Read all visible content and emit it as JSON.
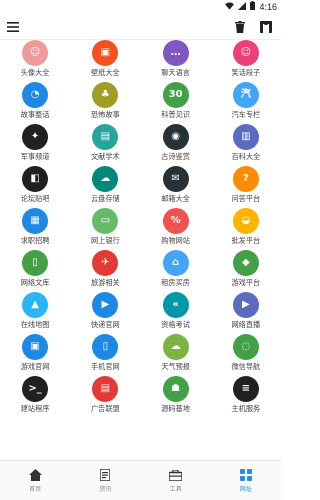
{
  "status_bar": {
    "time": "4:16"
  },
  "app_bar": {
    "menu_icon": "hamburger-menu-icon",
    "delete_icon": "trash-icon",
    "github_icon": "github-icon"
  },
  "grid": [
    {
      "label": "头像大全",
      "icon": "avatar-icon",
      "color": "#ef9a9a",
      "glyph": "☺"
    },
    {
      "label": "壁纸大全",
      "icon": "wallpaper-icon",
      "color": "#f4511e",
      "glyph": "▣"
    },
    {
      "label": "聊天语言",
      "icon": "chat-icon",
      "color": "#7e57c2",
      "glyph": "…"
    },
    {
      "label": "笑话段子",
      "icon": "joke-icon",
      "color": "#ec407a",
      "glyph": "☺"
    },
    {
      "label": "故事整话",
      "icon": "story-icon",
      "color": "#1e88e5",
      "glyph": "◔"
    },
    {
      "label": "恐怖故事",
      "icon": "horror-icon",
      "color": "#9e9d24",
      "glyph": "♣"
    },
    {
      "label": "科普见识",
      "icon": "science-icon",
      "color": "#43a047",
      "glyph": "30"
    },
    {
      "label": "汽车专栏",
      "icon": "car-icon",
      "color": "#42a5f5",
      "glyph": "汽"
    },
    {
      "label": "军事频道",
      "icon": "military-icon",
      "color": "#212121",
      "glyph": "✦"
    },
    {
      "label": "文献学术",
      "icon": "literature-icon",
      "color": "#26a69a",
      "glyph": "▤"
    },
    {
      "label": "古诗鉴赏",
      "icon": "poetry-icon",
      "color": "#263238",
      "glyph": "◉"
    },
    {
      "label": "百科大全",
      "icon": "encyclopedia-icon",
      "color": "#5c6bc0",
      "glyph": "▥"
    },
    {
      "label": "论坛贴吧",
      "icon": "forum-icon",
      "color": "#212121",
      "glyph": "◧"
    },
    {
      "label": "云盘存储",
      "icon": "cloud-storage-icon",
      "color": "#00897b",
      "glyph": "☁"
    },
    {
      "label": "邮箱大全",
      "icon": "mail-icon",
      "color": "#263238",
      "glyph": "✉"
    },
    {
      "label": "问答平台",
      "icon": "qa-icon",
      "color": "#fb8c00",
      "glyph": "?"
    },
    {
      "label": "求职招聘",
      "icon": "job-icon",
      "color": "#1e88e5",
      "glyph": "▦"
    },
    {
      "label": "网上银行",
      "icon": "bank-icon",
      "color": "#66bb6a",
      "glyph": "▭"
    },
    {
      "label": "购物网站",
      "icon": "shopping-icon",
      "color": "#ef5350",
      "glyph": "%"
    },
    {
      "label": "批发平台",
      "icon": "wholesale-icon",
      "color": "#ffb300",
      "glyph": "◒"
    },
    {
      "label": "网络文库",
      "icon": "library-icon",
      "color": "#43a047",
      "glyph": "▯"
    },
    {
      "label": "旅游相关",
      "icon": "travel-icon",
      "color": "#e53935",
      "glyph": "✈"
    },
    {
      "label": "租房买房",
      "icon": "house-icon",
      "color": "#42a5f5",
      "glyph": "⌂"
    },
    {
      "label": "游戏平台",
      "icon": "game-icon",
      "color": "#43a047",
      "glyph": "◆"
    },
    {
      "label": "在线地图",
      "icon": "map-icon",
      "color": "#29b6f6",
      "glyph": "▲"
    },
    {
      "label": "快递官网",
      "icon": "delivery-icon",
      "color": "#1e88e5",
      "glyph": "▶"
    },
    {
      "label": "资格考试",
      "icon": "exam-icon",
      "color": "#0097a7",
      "glyph": "«"
    },
    {
      "label": "网络直播",
      "icon": "live-stream-icon",
      "color": "#5c6bc0",
      "glyph": "▶"
    },
    {
      "label": "游戏官网",
      "icon": "game-site-icon",
      "color": "#1e88e5",
      "glyph": "▣"
    },
    {
      "label": "手机官网",
      "icon": "phone-icon",
      "color": "#1e88e5",
      "glyph": "▯"
    },
    {
      "label": "天气预报",
      "icon": "weather-icon",
      "color": "#7cb342",
      "glyph": "☁"
    },
    {
      "label": "微信导航",
      "icon": "wechat-icon",
      "color": "#43a047",
      "glyph": "◌"
    },
    {
      "label": "建站程序",
      "icon": "terminal-icon",
      "color": "#212121",
      "glyph": ">_"
    },
    {
      "label": "广告联盟",
      "icon": "ad-icon",
      "color": "#e53935",
      "glyph": "▤"
    },
    {
      "label": "源码基地",
      "icon": "android-icon",
      "color": "#43a047",
      "glyph": "☗"
    },
    {
      "label": "主机服务",
      "icon": "server-icon",
      "color": "#212121",
      "glyph": "≡"
    }
  ],
  "bottom_nav": [
    {
      "label": "首页",
      "icon": "home-icon",
      "active": false
    },
    {
      "label": "资讯",
      "icon": "news-icon",
      "active": false
    },
    {
      "label": "工具",
      "icon": "toolbox-icon",
      "active": false
    },
    {
      "label": "网址",
      "icon": "grid-icon",
      "active": true
    }
  ],
  "colors": {
    "accent": "#2b8be8",
    "nav_inactive": "#333333"
  }
}
